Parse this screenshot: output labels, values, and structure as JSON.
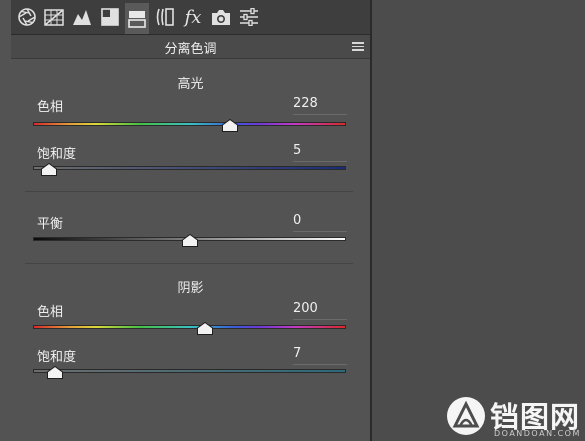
{
  "panel": {
    "title": "分离色调",
    "tabs": [
      "basic-aperture-icon",
      "tone-curve-grid-icon",
      "detail-triangle-icon",
      "hsl-icon",
      "split-toning-icon",
      "lens-corrections-icon",
      "effects-fx-icon",
      "camera-calibration-icon",
      "presets-sliders-icon"
    ],
    "tab_fx_label": "fx",
    "highlights": {
      "title": "高光",
      "hue": {
        "label": "色相",
        "value": "228",
        "fraction": 0.63
      },
      "saturation": {
        "label": "饱和度",
        "value": "5",
        "fraction": 0.05
      }
    },
    "balance": {
      "label": "平衡",
      "value": "0",
      "fraction": 0.5
    },
    "shadows": {
      "title": "阴影",
      "hue": {
        "label": "色相",
        "value": "200",
        "fraction": 0.55
      },
      "saturation": {
        "label": "饱和度",
        "value": "7",
        "fraction": 0.07
      }
    }
  },
  "watermark": {
    "text": "铛图网",
    "sub": "DOANDOAN.COM"
  }
}
